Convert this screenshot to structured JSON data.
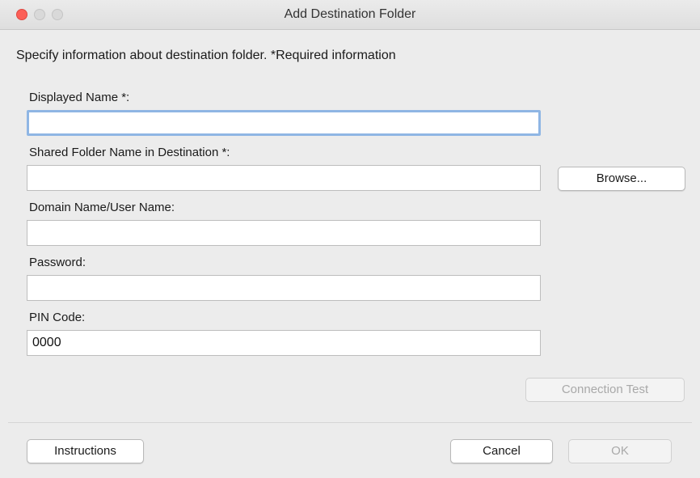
{
  "window": {
    "title": "Add Destination Folder"
  },
  "instruction": "Specify information about destination folder. *Required information",
  "fields": {
    "displayed_name": {
      "label": "Displayed Name *:",
      "value": ""
    },
    "shared_folder": {
      "label": "Shared Folder Name in Destination *:",
      "value": ""
    },
    "domain_user": {
      "label": "Domain Name/User Name:",
      "value": ""
    },
    "password": {
      "label": "Password:",
      "value": ""
    },
    "pin_code": {
      "label": "PIN Code:",
      "value": "0000"
    }
  },
  "buttons": {
    "browse": "Browse...",
    "connection_test": "Connection Test",
    "instructions": "Instructions",
    "cancel": "Cancel",
    "ok": "OK"
  },
  "colors": {
    "close": "#fc5f57",
    "focus_ring": "#8fb6e4",
    "disabled_text": "#a9a9a9"
  }
}
